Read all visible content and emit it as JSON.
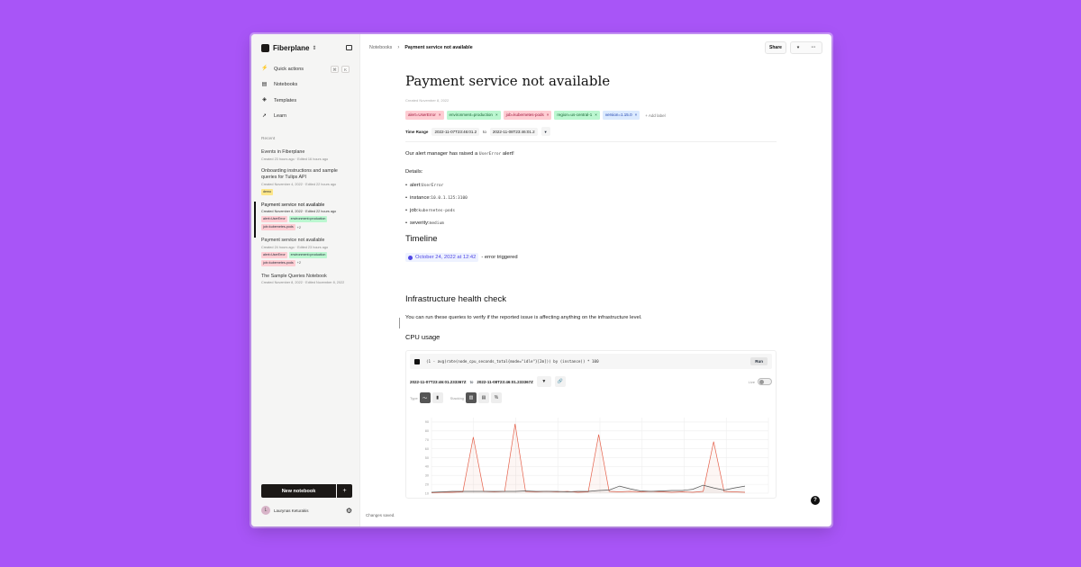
{
  "workspace": {
    "name": "Fiberplane"
  },
  "nav": [
    {
      "label": "Quick actions",
      "icon": "lightning-icon",
      "shortcut": [
        "⌘",
        "K"
      ]
    },
    {
      "label": "Notebooks",
      "icon": "notebooks-icon"
    },
    {
      "label": "Templates",
      "icon": "templates-icon"
    },
    {
      "label": "Learn",
      "icon": "rocket-icon"
    }
  ],
  "recent": {
    "title": "Recent",
    "items": [
      {
        "title": "Events in Fiberplane",
        "meta": "Created 23 hours ago · Edited 16 hours ago",
        "tags": []
      },
      {
        "title": "Onboarding instructions and sample queries for Tulips API",
        "meta": "Created November 4, 2022 · Edited 22 hours ago",
        "tags": [
          {
            "text": "demo",
            "color": "#fde68a"
          }
        ]
      },
      {
        "title": "Payment service not available",
        "meta": "Created November 8, 2022 · Edited 22 hours ago",
        "tags": [
          {
            "text": "alert=UserError",
            "color": "#fecdd3"
          },
          {
            "text": "environment=production",
            "color": "#bbf7d0"
          },
          {
            "text": "job=kubernetes-pods",
            "color": "#fecdd3"
          }
        ],
        "more": "+2"
      },
      {
        "title": "Payment service not available",
        "meta": "Created 24 hours ago · Edited 23 hours ago",
        "tags": [
          {
            "text": "alert=UserError",
            "color": "#fecdd3"
          },
          {
            "text": "environment=production",
            "color": "#bbf7d0"
          },
          {
            "text": "job=kubernetes-pods",
            "color": "#fecdd3"
          }
        ],
        "more": "+2"
      },
      {
        "title": "The Sample Queries Notebook",
        "meta": "Created November 8, 2022 · Edited November 8, 2022",
        "tags": []
      }
    ]
  },
  "new_notebook_label": "New notebook",
  "new_notebook_plus": "+",
  "user": {
    "initial": "L",
    "name": "Laurynas Keturakis"
  },
  "breadcrumb": {
    "root": "Notebooks",
    "current": "Payment service not available"
  },
  "top_buttons": {
    "share": "Share"
  },
  "notebook": {
    "title": "Payment service not available",
    "created": "Created November 8, 2022",
    "labels": [
      {
        "text": "alert=UserError",
        "color": "#fecdd3",
        "fg": "#9f1239"
      },
      {
        "text": "environment=production",
        "color": "#bbf7d0",
        "fg": "#166534"
      },
      {
        "text": "job=kubernetes-pods",
        "color": "#fecdd3",
        "fg": "#9f1239"
      },
      {
        "text": "region=us-central-1",
        "color": "#bbf7d0",
        "fg": "#166534"
      },
      {
        "text": "version=1.15.0",
        "color": "#dbeafe",
        "fg": "#1e40af"
      }
    ],
    "add_label": "Add label",
    "time_range": {
      "label": "Time Range",
      "from": "2022-11-07T23:46:01.2",
      "to_word": "to",
      "to": "2022-11-08T23:46:01.2"
    },
    "intro_before": "Our alert manager has raised a",
    "intro_code": "UserError",
    "intro_after": "alert!",
    "details_label": "Details:",
    "details": [
      {
        "key": "alert:",
        "value": "UserError"
      },
      {
        "key": "instance:",
        "value": "10.0.1.125:3100"
      },
      {
        "key": "job:",
        "value": "kubernetes-pods"
      },
      {
        "key": "severity:",
        "value": "medium"
      }
    ],
    "timeline_heading": "Timeline",
    "timeline_date": "October 24, 2022 at 12:42",
    "timeline_text": "- error triggered",
    "infra_heading": "Infrastructure health check",
    "infra_text": "You can run these queries to verify if the reported issue is affecting anything on the infrastructure level.",
    "cpu_heading": "CPU usage",
    "query": "(1 - avg(rate(node_cpu_seconds_total{mode=\"idle\"}[2m])) by (instance)) * 100",
    "run_label": "Run",
    "cell_range": {
      "from": "2022-11-07T23:46:01.233367Z",
      "to_word": "to",
      "to": "2022-11-08T23:46:01.233367Z"
    },
    "live_label": "Live",
    "type_label": "Type",
    "stacking_label": "Stacking"
  },
  "chart_data": {
    "type": "line",
    "yticks": [
      10,
      20,
      30,
      40,
      50,
      60,
      70,
      80,
      90
    ],
    "ylim": [
      10,
      95
    ],
    "grid": true,
    "series": [
      {
        "color": "#e5604a",
        "values": [
          10.5,
          11,
          11,
          11.5,
          73,
          12,
          11.5,
          12,
          88,
          12,
          11.5,
          12,
          11.5,
          12,
          11,
          11.5,
          76,
          12,
          11.5,
          12,
          11.5,
          12,
          11.5,
          11,
          11.5,
          11,
          12,
          68,
          12,
          11.5,
          11
        ]
      },
      {
        "color": "#555555",
        "values": [
          11,
          11.5,
          12,
          12,
          12,
          12,
          12,
          12,
          12,
          12.5,
          12,
          12,
          12,
          11.5,
          12,
          12,
          13,
          13.5,
          18,
          15,
          12.5,
          12,
          12.5,
          13,
          13,
          14.5,
          19,
          16,
          13.5,
          16,
          18
        ]
      }
    ]
  },
  "status": {
    "saved": "Changes saved."
  },
  "colors": {
    "background": "#a855f7",
    "accent": "#4f46e5"
  }
}
